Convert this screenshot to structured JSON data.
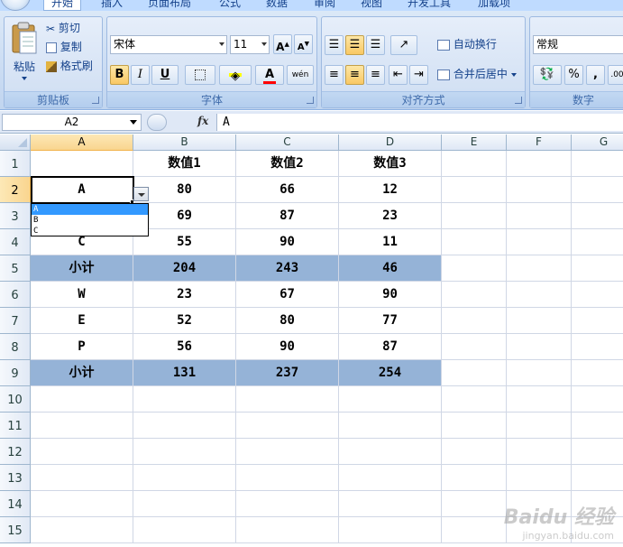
{
  "tabs": [
    {
      "label": "开始",
      "active": true
    },
    {
      "label": "插入"
    },
    {
      "label": "页面布局"
    },
    {
      "label": "公式"
    },
    {
      "label": "数据"
    },
    {
      "label": "审阅"
    },
    {
      "label": "视图"
    },
    {
      "label": "开发工具"
    },
    {
      "label": "加载项"
    }
  ],
  "ribbon": {
    "clipboard": {
      "group": "剪贴板",
      "paste": "粘贴",
      "cut": "剪切",
      "copy": "复制",
      "format_painter": "格式刷"
    },
    "font": {
      "group": "字体",
      "name": "宋体",
      "size": "11",
      "bold": "B",
      "italic": "I",
      "underline": "U",
      "font_color": "A",
      "phonetic": "wén"
    },
    "alignment": {
      "group": "对齐方式",
      "wrap": "自动换行",
      "merge": "合并后居中"
    },
    "number": {
      "group": "数字",
      "format": "常规",
      "percent": "%",
      "comma": ","
    }
  },
  "formula_bar": {
    "name_box": "A2",
    "fx": "fx",
    "content": "A"
  },
  "columns": [
    "A",
    "B",
    "C",
    "D",
    "E",
    "F",
    "G"
  ],
  "selected_column": "A",
  "rows": [
    "1",
    "2",
    "3",
    "4",
    "5",
    "6",
    "7",
    "8",
    "9",
    "10",
    "11",
    "12",
    "13",
    "14",
    "15"
  ],
  "selected_row": "2",
  "table": {
    "header": [
      "",
      "数值1",
      "数值2",
      "数值3"
    ],
    "rows": [
      [
        "A",
        "80",
        "66",
        "12"
      ],
      [
        "",
        "69",
        "87",
        "23"
      ],
      [
        "C",
        "55",
        "90",
        "11"
      ],
      [
        "小计",
        "204",
        "243",
        "46"
      ],
      [
        "W",
        "23",
        "67",
        "90"
      ],
      [
        "E",
        "52",
        "80",
        "77"
      ],
      [
        "P",
        "56",
        "90",
        "87"
      ],
      [
        "小计",
        "131",
        "237",
        "254"
      ]
    ]
  },
  "dropdown": {
    "options": [
      "A",
      "B",
      "C"
    ],
    "highlighted": 0
  },
  "colors": {
    "subtotal_fill": "#95b3d7",
    "ribbon": "#c8daf2",
    "selection_header": "#f9d58f"
  },
  "watermark": {
    "brand": "Baidu 经验",
    "url": "jingyan.baidu.com"
  }
}
